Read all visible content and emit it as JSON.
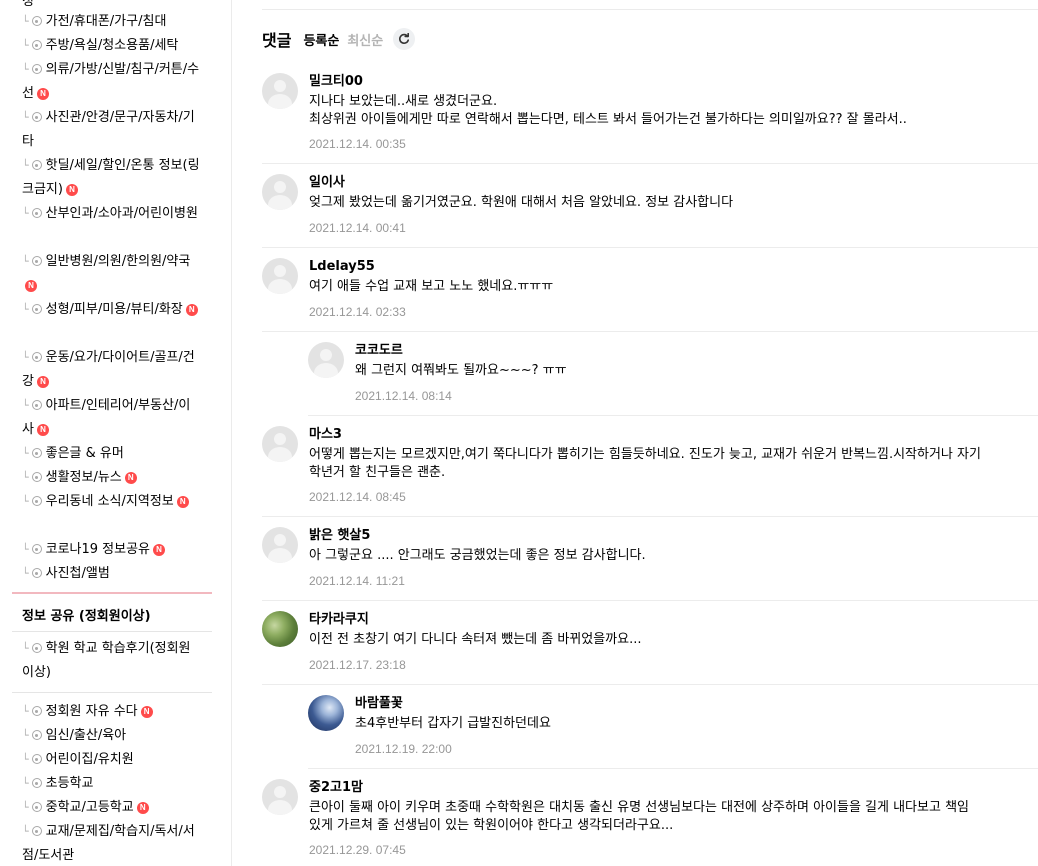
{
  "sidebar": {
    "top_fragment": "청",
    "items": [
      {
        "label": "가전/휴대폰/가구/침대",
        "new": false
      },
      {
        "label": "주방/욕실/청소용품/세탁",
        "new": false
      },
      {
        "label": "의류/가방/신발/침구/커튼/수선",
        "new": true
      },
      {
        "label": "사진관/안경/문구/자동차/기타",
        "new": false
      },
      {
        "label": "핫딜/세일/할인/온통 정보(링크금지)",
        "new": true
      },
      {
        "label": "산부인과/소아과/어린이병원",
        "new": false
      },
      {
        "label": "일반병원/의원/한의원/약국",
        "new": true
      },
      {
        "label": "성형/피부/미용/뷰티/화장",
        "new": true
      },
      {
        "label": "운동/요가/다이어트/골프/건강",
        "new": true
      },
      {
        "label": "아파트/인테리어/부동산/이사",
        "new": true
      },
      {
        "label": "좋은글 & 유머",
        "new": false
      },
      {
        "label": "생활정보/뉴스",
        "new": true
      },
      {
        "label": "우리동네 소식/지역정보",
        "new": true
      },
      {
        "label": "코로나19 정보공유",
        "new": true
      },
      {
        "label": "사진첩/앨범",
        "new": false
      }
    ],
    "section_title": "정보 공유 (정회원이상)",
    "section_items": [
      {
        "label": "학원 학교 학습후기(정회원이상)",
        "new": false
      }
    ],
    "items2": [
      {
        "label": "정회원 자유 수다",
        "new": true
      },
      {
        "label": "임신/출산/육아",
        "new": false
      },
      {
        "label": "어린이집/유치원",
        "new": false
      },
      {
        "label": "초등학교",
        "new": false
      },
      {
        "label": "중학교/고등학교",
        "new": true
      },
      {
        "label": "교재/문제집/학습지/독서/서점/도서관",
        "new": false
      }
    ],
    "new_badge": "N"
  },
  "comments": {
    "title": "댓글",
    "sort_registered": "등록순",
    "sort_latest": "최신순",
    "items": [
      {
        "nick": "밀크티00",
        "text": "지나다 보았는데..새로 생겼더군요.\n최상위권 아이들에게만 따로 연락해서 뽑는다면, 테스트 봐서 들어가는건 불가하다는 의미일까요?? 잘 몰라서..",
        "date": "2021.12.14. 00:35",
        "reply": false,
        "avatar": "default"
      },
      {
        "nick": "일이사",
        "text": "엊그제 봤었는데 옮기거였군요. 학원애 대해서 처음 알았네요. 정보 감사합니다",
        "date": "2021.12.14. 00:41",
        "reply": false,
        "avatar": "default"
      },
      {
        "nick": "Ldelay55",
        "text": "여기 애들 수업 교재 보고 노노 했네요.ㅠㅠㅠ",
        "date": "2021.12.14. 02:33",
        "reply": false,
        "avatar": "default"
      },
      {
        "nick": "코코도르",
        "text": "왜 그런지 여쭤봐도 될까요~~~? ㅠㅠ",
        "date": "2021.12.14. 08:14",
        "reply": true,
        "avatar": "default"
      },
      {
        "nick": "마스3",
        "text": "어떻게 뽑는지는 모르겠지만,여기 쭉다니다가 뽑히기는 힘들듯하네요. 진도가 늦고, 교재가 쉬운거 반복느낌.시작하거나 자기\n학년거 할 친구들은 괜춘.",
        "date": "2021.12.14. 08:45",
        "reply": false,
        "avatar": "default"
      },
      {
        "nick": "밝은 햇살5",
        "text": "아 그렇군요 .... 안그래도 궁금했었는데 좋은 정보 감사합니다.",
        "date": "2021.12.14. 11:21",
        "reply": false,
        "avatar": "default"
      },
      {
        "nick": "타카라쿠지",
        "text": "이전 전 초창기 여기 다니다 속터져 뺐는데 좀 바뀌었을까요...",
        "date": "2021.12.17. 23:18",
        "reply": false,
        "avatar": "photo-green"
      },
      {
        "nick": "바람풀꽃",
        "text": "초4후반부터 갑자기 급발진하던데요",
        "date": "2021.12.19. 22:00",
        "reply": true,
        "avatar": "photo-blue"
      },
      {
        "nick": "중2고1맘",
        "text": "큰아이 둘째 아이 키우며 초중때 수학학원은 대치동 출신 유명 선생님보다는 대전에 상주하며 아이들을 길게 내다보고 책임\n있게 가르쳐 줄 선생님이 있는 학원이어야 한다고 생각되더라구요...",
        "date": "2021.12.29. 07:45",
        "reply": false,
        "avatar": "default"
      }
    ]
  }
}
